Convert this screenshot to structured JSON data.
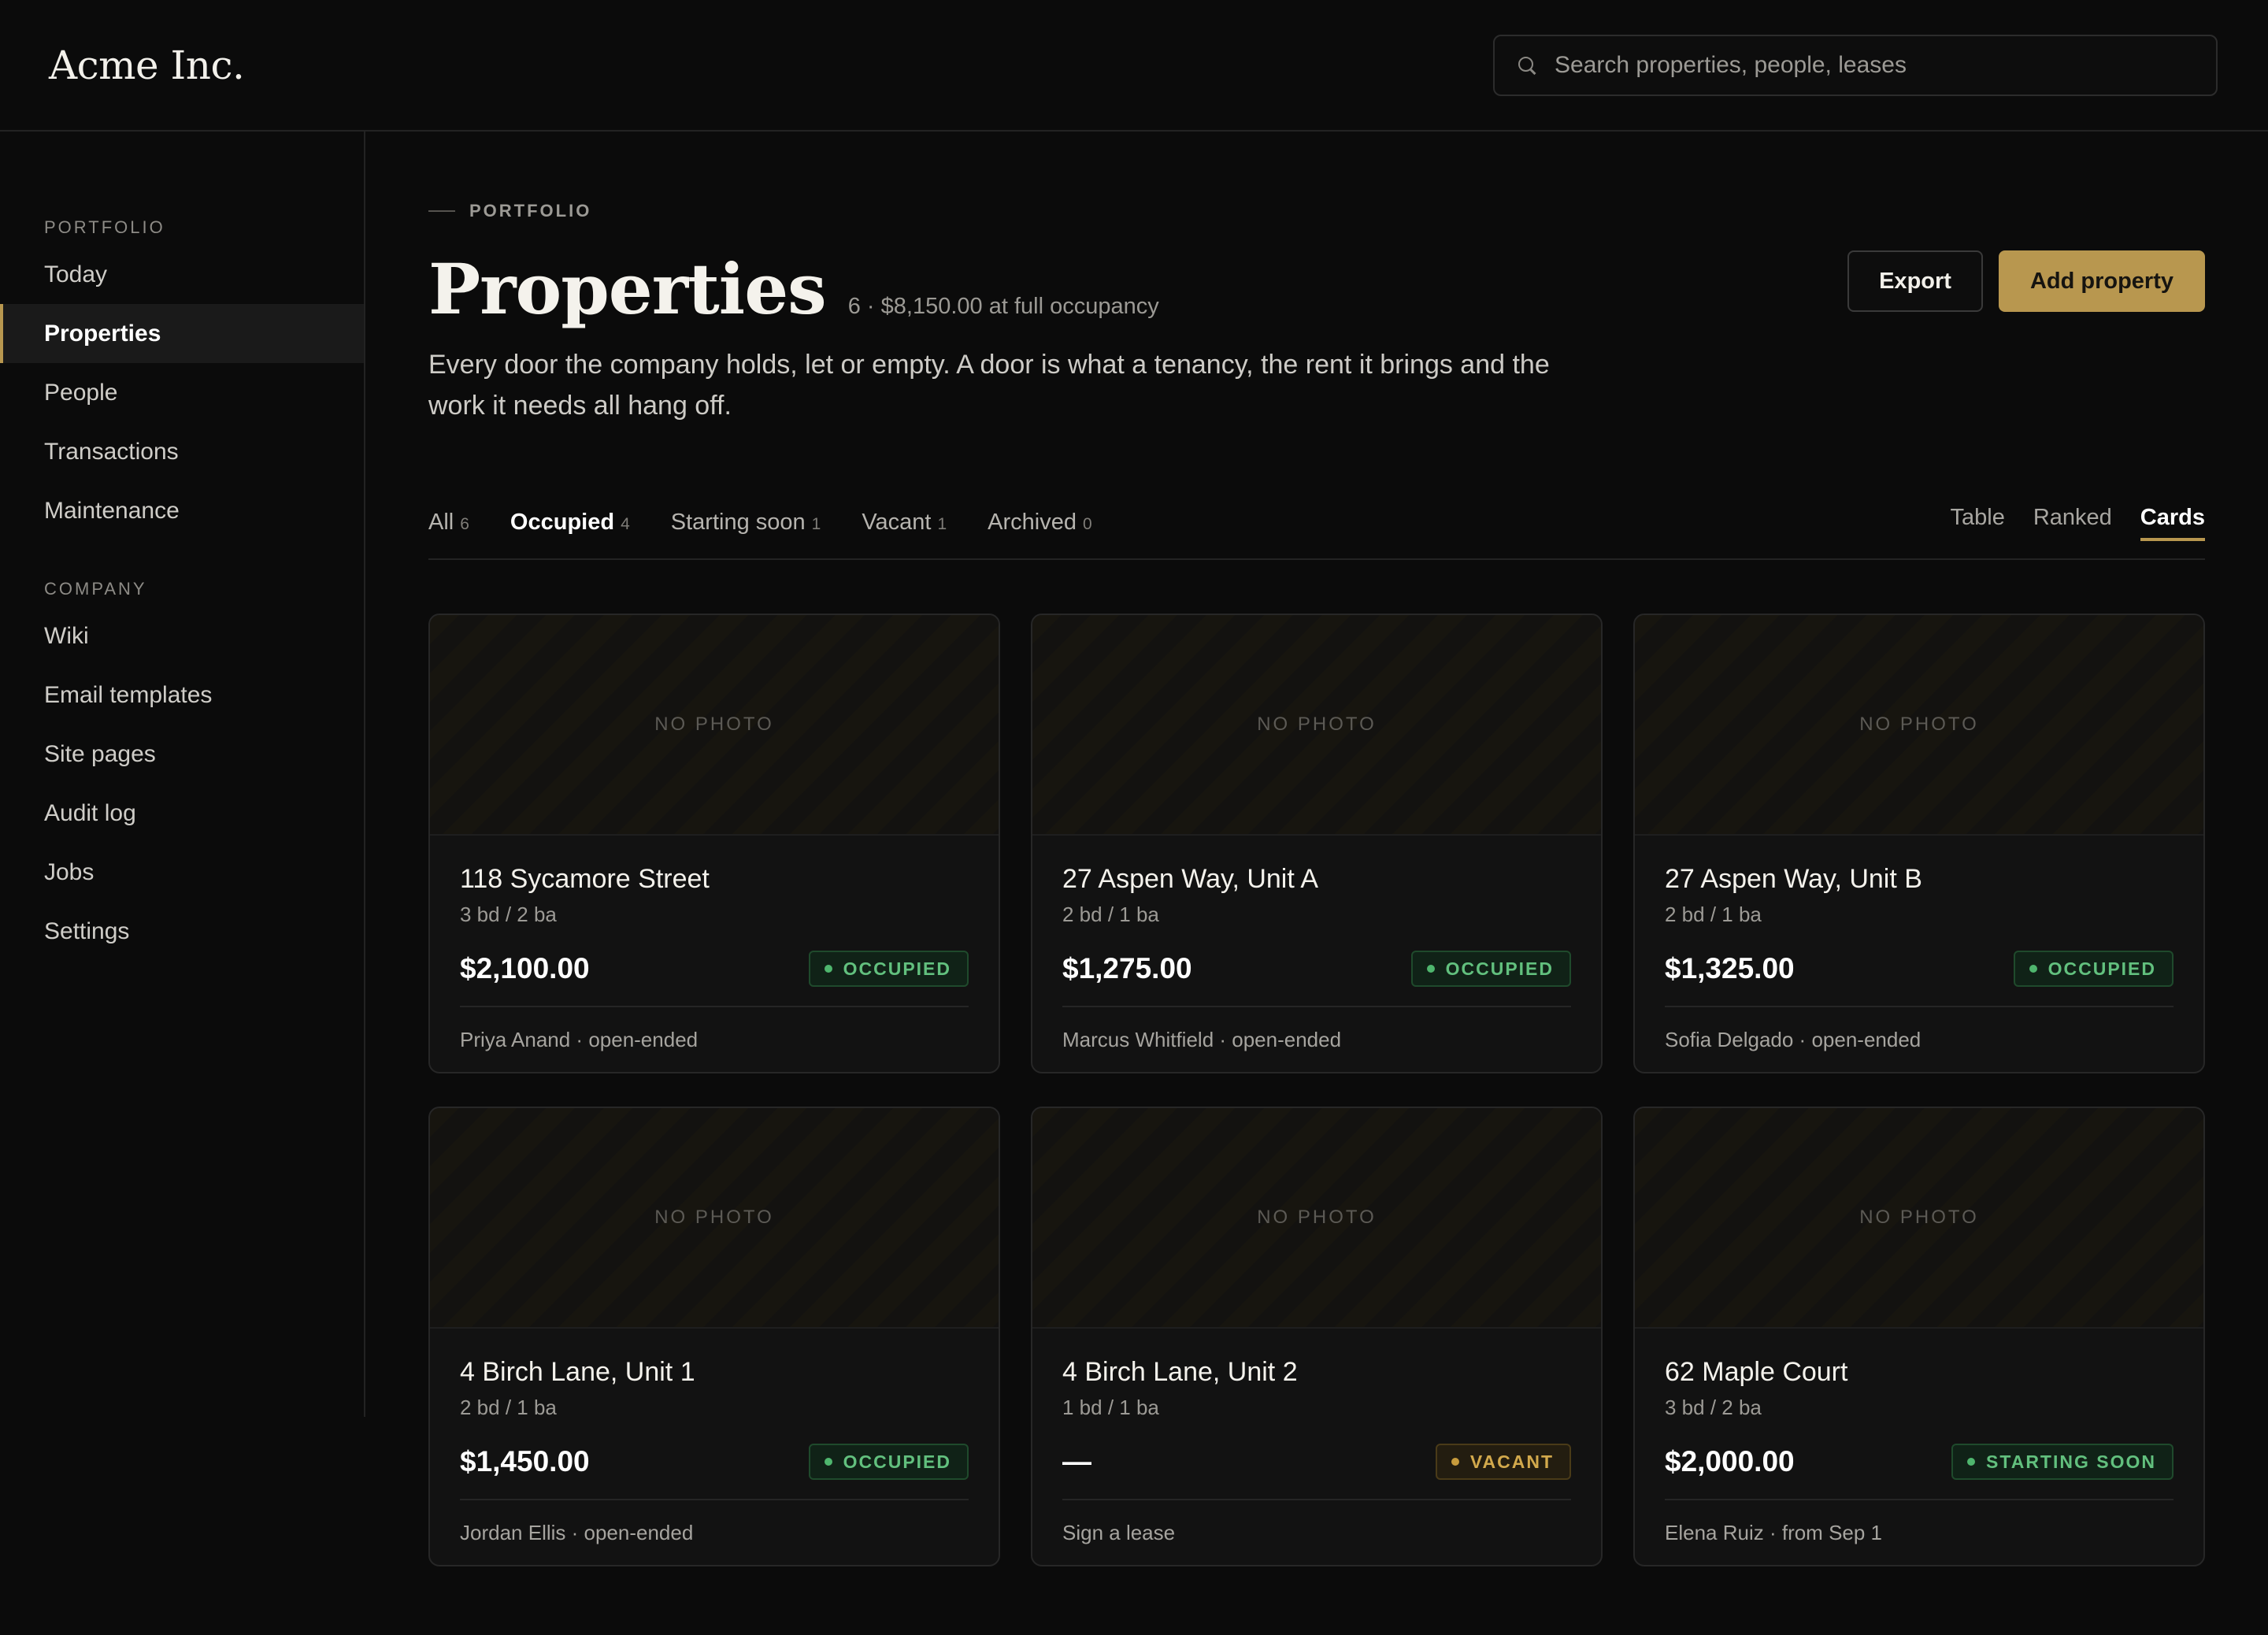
{
  "app": {
    "brand": "Acme Inc."
  },
  "search": {
    "placeholder": "Search properties, people, leases"
  },
  "sidebar": {
    "sections": [
      {
        "label": "PORTFOLIO",
        "items": [
          "Today",
          "Properties",
          "People",
          "Transactions",
          "Maintenance"
        ]
      },
      {
        "label": "COMPANY",
        "items": [
          "Wiki",
          "Email templates",
          "Site pages",
          "Audit log",
          "Jobs",
          "Settings"
        ]
      }
    ],
    "active": "Properties"
  },
  "page": {
    "eyebrow": "PORTFOLIO",
    "title": "Properties",
    "meta": "6 · $8,150.00 at full occupancy",
    "description": "Every door the company holds, let or empty. A door is what a tenancy, the rent it brings and the work it needs all hang off."
  },
  "actions": {
    "export": "Export",
    "add": "Add property"
  },
  "tabs": [
    {
      "label": "All",
      "count": "6"
    },
    {
      "label": "Occupied",
      "count": "4"
    },
    {
      "label": "Starting soon",
      "count": "1"
    },
    {
      "label": "Vacant",
      "count": "1"
    },
    {
      "label": "Archived",
      "count": "0"
    }
  ],
  "active_tab": "Occupied",
  "views": [
    "Table",
    "Ranked",
    "Cards"
  ],
  "active_view": "Cards",
  "photo_placeholder": "NO PHOTO",
  "colors": {
    "accent": "#b8974f",
    "occupied": "#62c07e",
    "vacant": "#d2a94c",
    "background": "#0b0b0b"
  },
  "properties": [
    {
      "name": "118 Sycamore Street",
      "size": "3 bd / 2 ba",
      "rent": "$2,100.00",
      "status": "OCCUPIED",
      "tone": "green",
      "tenant": "Priya Anand · open-ended"
    },
    {
      "name": "27 Aspen Way, Unit A",
      "size": "2 bd / 1 ba",
      "rent": "$1,275.00",
      "status": "OCCUPIED",
      "tone": "green",
      "tenant": "Marcus Whitfield · open-ended"
    },
    {
      "name": "27 Aspen Way, Unit B",
      "size": "2 bd / 1 ba",
      "rent": "$1,325.00",
      "status": "OCCUPIED",
      "tone": "green",
      "tenant": "Sofia Delgado · open-ended"
    },
    {
      "name": "4 Birch Lane, Unit 1",
      "size": "2 bd / 1 ba",
      "rent": "$1,450.00",
      "status": "OCCUPIED",
      "tone": "green",
      "tenant": "Jordan Ellis · open-ended"
    },
    {
      "name": "4 Birch Lane, Unit 2",
      "size": "1 bd / 1 ba",
      "rent": "—",
      "status": "VACANT",
      "tone": "amber",
      "tenant": "Sign a lease"
    },
    {
      "name": "62 Maple Court",
      "size": "3 bd / 2 ba",
      "rent": "$2,000.00",
      "status": "STARTING SOON",
      "tone": "green",
      "tenant": "Elena Ruiz · from Sep 1"
    }
  ]
}
